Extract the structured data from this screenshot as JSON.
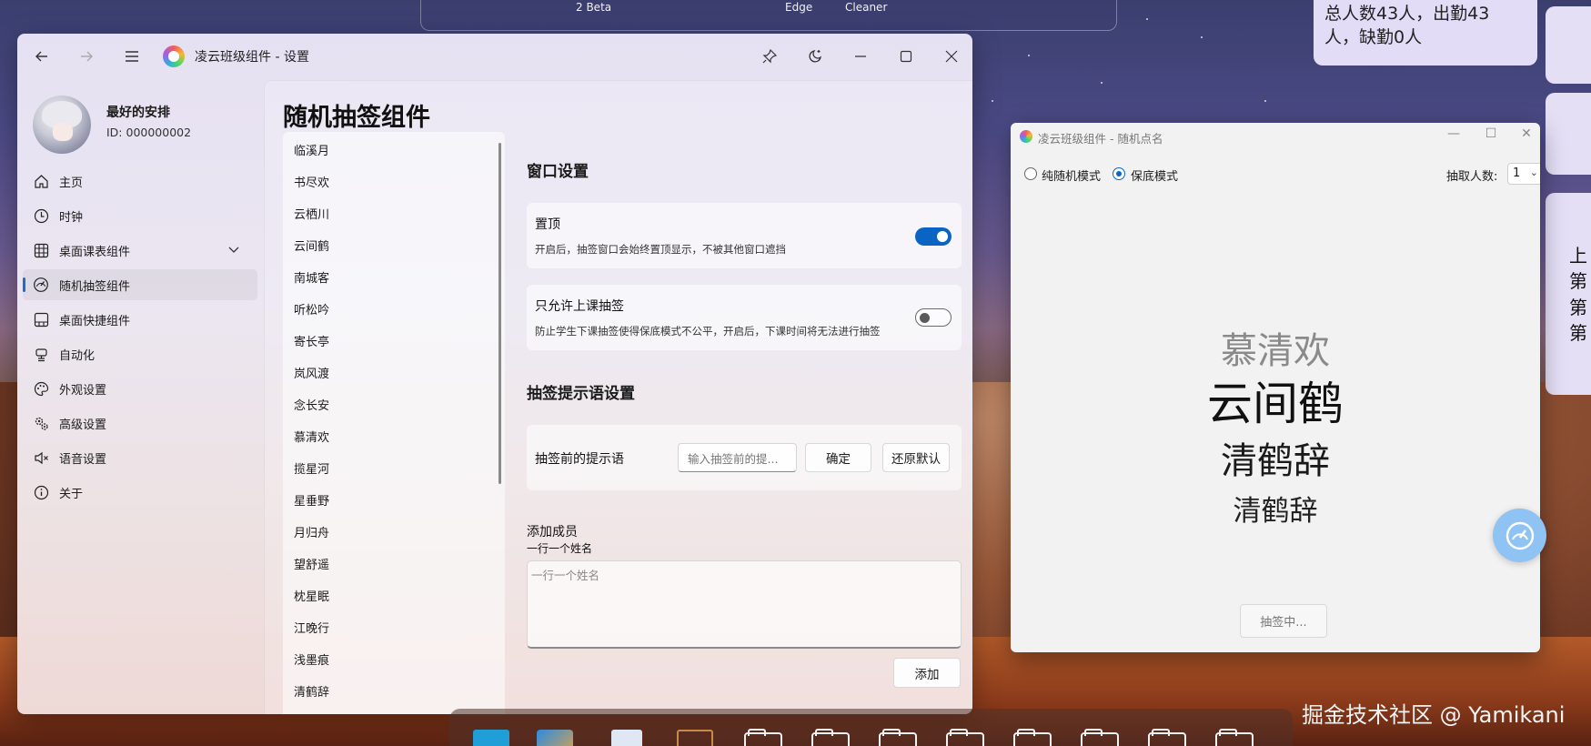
{
  "desktop": {
    "top_card_labels": [
      "2 Beta",
      "Edge",
      "Cleaner"
    ],
    "note_widget_lines": [
      "总人数43人，出勤43",
      "人，缺勤0人"
    ],
    "side_chars": [
      "上",
      "第",
      "第",
      "第"
    ],
    "watermark": "掘金技术社区 @ Yamikani"
  },
  "settings_window": {
    "title": "凌云班级组件 - 设置",
    "user": {
      "name": "最好的安排",
      "id": "ID: 000000002"
    },
    "nav": [
      {
        "label": "主页",
        "icon": "home-icon"
      },
      {
        "label": "时钟",
        "icon": "clock-icon"
      },
      {
        "label": "桌面课表组件",
        "icon": "grid-icon",
        "expandable": true
      },
      {
        "label": "随机抽签组件",
        "icon": "speedometer-icon",
        "active": true
      },
      {
        "label": "桌面快捷组件",
        "icon": "shortcut-icon"
      },
      {
        "label": "自动化",
        "icon": "robot-icon"
      },
      {
        "label": "外观设置",
        "icon": "palette-icon"
      },
      {
        "label": "高级设置",
        "icon": "gears-icon"
      },
      {
        "label": "语音设置",
        "icon": "speaker-icon"
      },
      {
        "label": "关于",
        "icon": "info-icon"
      }
    ],
    "page_title": "随机抽签组件",
    "names": [
      "临溪月",
      "书尽欢",
      "云栖川",
      "云间鹤",
      "南城客",
      "听松吟",
      "寄长亭",
      "岚风渡",
      "念长安",
      "慕清欢",
      "揽星河",
      "星垂野",
      "月归舟",
      "望舒遥",
      "枕星眠",
      "江晚行",
      "浅墨痕",
      "清鹤辞"
    ],
    "window_section": {
      "heading": "窗口设置",
      "topmost": {
        "title": "置顶",
        "desc": "开启后，抽签窗口会始终置顶显示，不被其他窗口遮挡",
        "on": true
      },
      "class_only": {
        "title": "只允许上课抽签",
        "desc": "防止学生下课抽签使得保底模式不公平，开启后，下课时间将无法进行抽签",
        "on": false
      }
    },
    "hint_section": {
      "heading": "抽签提示语设置",
      "label": "抽签前的提示语",
      "input_placeholder": "输入抽签前的提...",
      "confirm": "确定",
      "reset": "还原默认"
    },
    "add_member": {
      "title": "添加成员",
      "subtitle": "一行一个姓名",
      "placeholder": "一行一个姓名",
      "add_button": "添加"
    }
  },
  "pick_window": {
    "title": "凌云班级组件 - 随机点名",
    "mode_random": "纯随机模式",
    "mode_guarantee": "保底模式",
    "selected_mode": "保底模式",
    "count_label": "抽取人数:",
    "count_value": "1",
    "names_shown": [
      "慕清欢",
      "云间鹤",
      "清鹤辞",
      "清鹤辞"
    ],
    "button": "抽签中..."
  }
}
